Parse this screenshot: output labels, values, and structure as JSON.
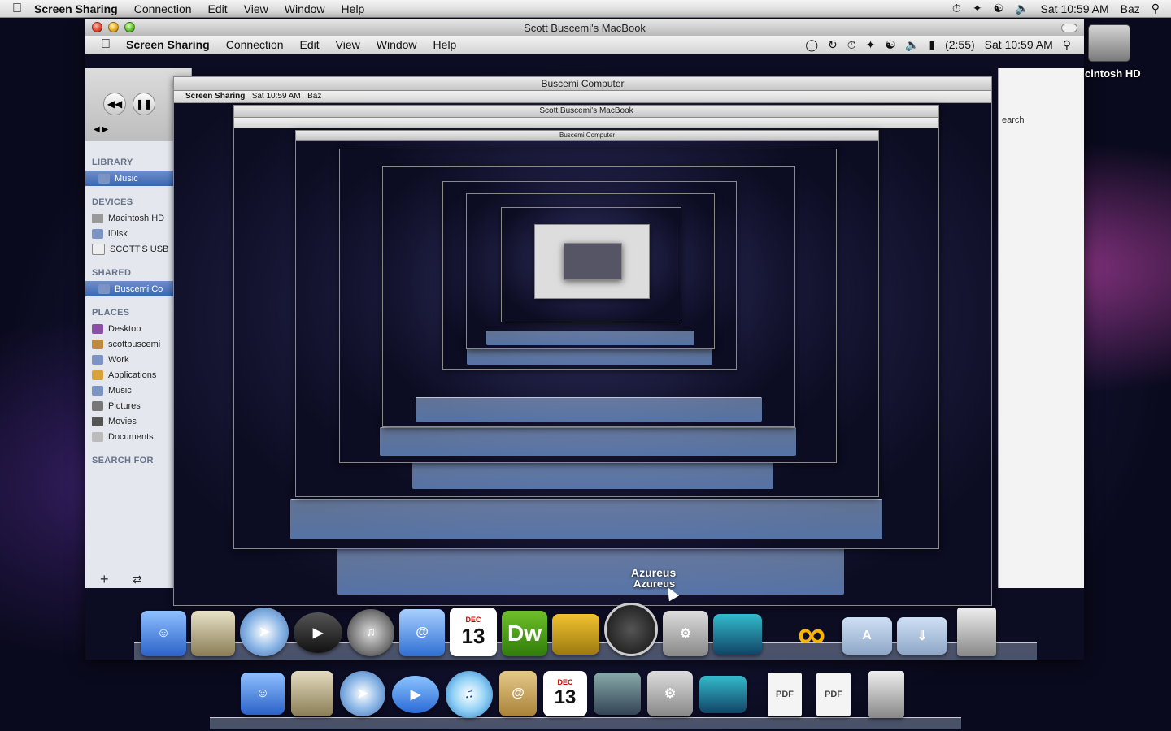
{
  "menubar": {
    "app": "Screen Sharing",
    "items": [
      "Connection",
      "Edit",
      "View",
      "Window",
      "Help"
    ],
    "clock": "Sat 10:59 AM",
    "user": "Baz"
  },
  "window": {
    "title": "Scott Buscemi's MacBook"
  },
  "remote_menubar": {
    "app": "Screen Sharing",
    "items": [
      "Connection",
      "Edit",
      "View",
      "Window",
      "Help"
    ],
    "battery": "(2:55)",
    "clock": "Sat 10:59 AM"
  },
  "nested": {
    "level2_title": "Buscemi Computer",
    "level2_clock": "Sat 10:59 AM",
    "level2_user": "Baz",
    "level3_title": "Scott Buscemi's MacBook",
    "level4_title": "Buscemi Computer"
  },
  "finder": {
    "sections": {
      "library": "LIBRARY",
      "devices": "DEVICES",
      "shared": "SHARED",
      "places": "PLACES",
      "search": "SEARCH FOR"
    },
    "library_items": [
      "Music"
    ],
    "devices": [
      "Macintosh HD",
      "iDisk",
      "SCOTT'S USB"
    ],
    "shared": [
      "Buscemi Co"
    ],
    "places": [
      "Desktop",
      "scottbuscemi",
      "Work",
      "Applications",
      "Music",
      "Pictures",
      "Movies",
      "Documents"
    ],
    "search_placeholder": "earch"
  },
  "desktop": {
    "hd_label": "cintosh HD"
  },
  "dock": {
    "azureus_label": "Azureus",
    "ical_day": "13",
    "ical_month": "DEC",
    "dw_label": "Dw",
    "icons": [
      "finder-icon",
      "preview-icon",
      "safari-icon",
      "ichat-icon",
      "itunes-icon",
      "address-book-icon",
      "ical-icon",
      "iphoto-icon",
      "system-preferences-icon",
      "spaces-icon",
      "stack-icon",
      "pdf-document-icon",
      "pdf-document-icon",
      "trash-icon"
    ],
    "pdf_label": "PDF"
  }
}
